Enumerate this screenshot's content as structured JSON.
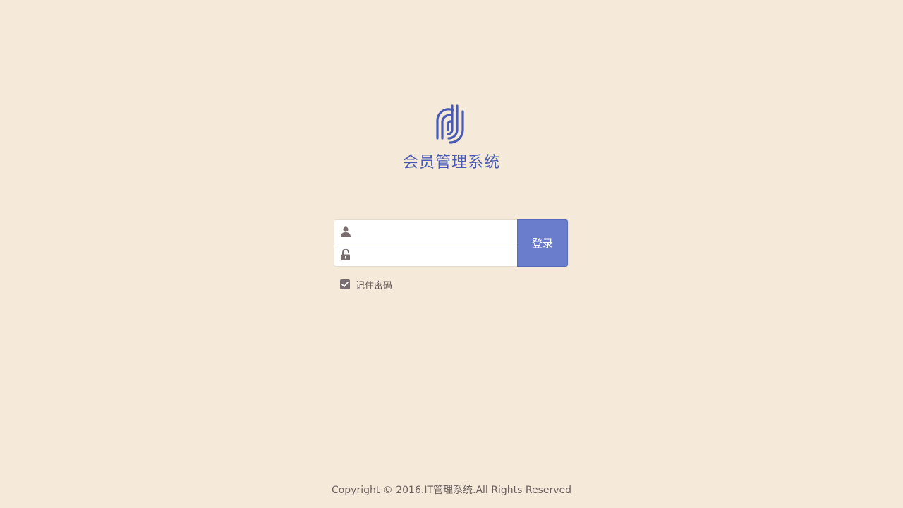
{
  "app": {
    "logo_icon": "fingerprint-logo-icon",
    "title": "会员管理系统",
    "brand_color": "#4a5bb5"
  },
  "login_form": {
    "username": {
      "icon": "user-icon",
      "value": "",
      "placeholder": ""
    },
    "password": {
      "icon": "lock-icon",
      "value": "",
      "placeholder": ""
    },
    "submit_label": "登录",
    "button_color": "#6a7ccc",
    "remember": {
      "label": "记住密码",
      "checked": true
    }
  },
  "footer": {
    "copyright": "Copyright © 2016.IT管理系统.All Rights Reserved"
  }
}
